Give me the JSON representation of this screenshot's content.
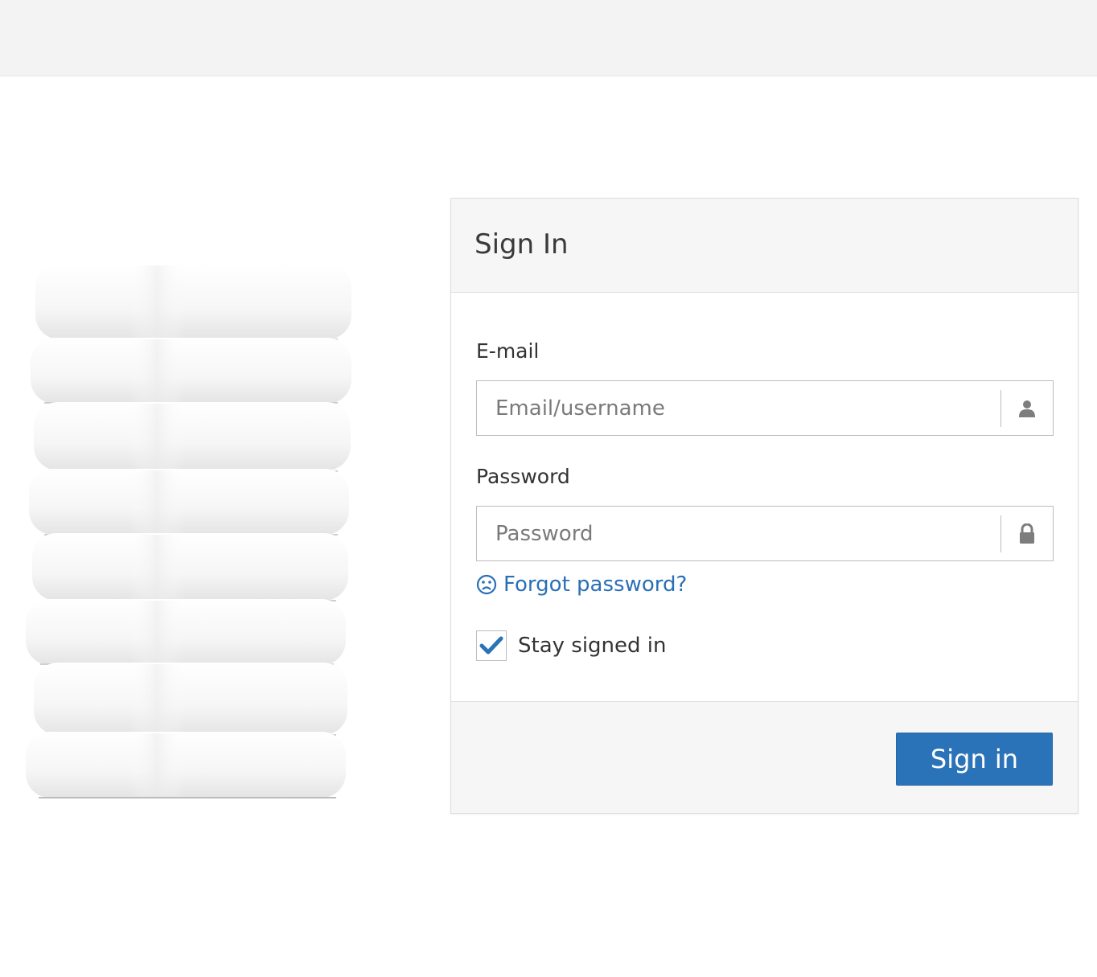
{
  "panel": {
    "title": "Sign In"
  },
  "email": {
    "label": "E-mail",
    "placeholder": "Email/username",
    "value": "",
    "icon": "user-icon"
  },
  "password": {
    "label": "Password",
    "placeholder": "Password",
    "value": "",
    "icon": "lock-icon"
  },
  "forgot": {
    "label": "Forgot password?",
    "icon": "sad-face-icon"
  },
  "stay_signed_in": {
    "label": "Stay signed in",
    "checked": true
  },
  "footer": {
    "sign_in_label": "Sign in"
  },
  "colors": {
    "accent": "#2b73b8",
    "link": "#2a6fb5",
    "topbar": "#f3f3f3",
    "panel_heading": "#f6f6f6"
  },
  "image": {
    "subject": "towels-stack"
  }
}
